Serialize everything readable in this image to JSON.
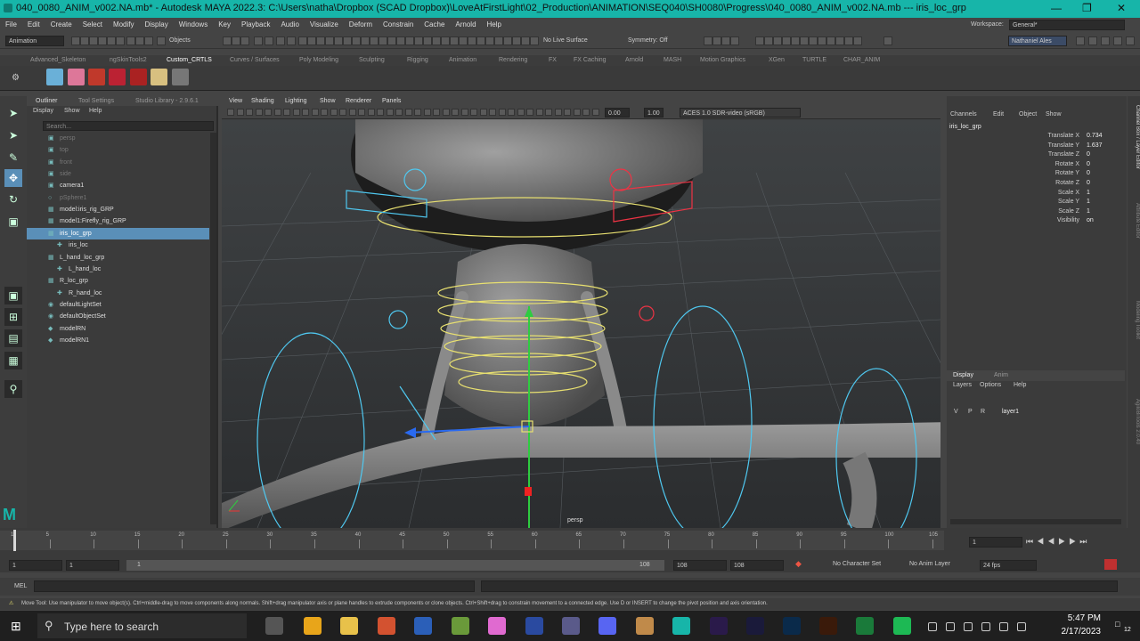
{
  "window": {
    "title": "040_0080_ANIM_v002.NA.mb* - Autodesk MAYA 2022.3: C:\\Users\\natha\\Dropbox (SCAD Dropbox)\\LoveAtFirstLight\\02_Production\\ANIMATION\\SEQ040\\SH0080\\Progress\\040_0080_ANIM_v002.NA.mb   ---   iris_loc_grp"
  },
  "menus": [
    "File",
    "Edit",
    "Create",
    "Select",
    "Modify",
    "Display",
    "Windows",
    "Key",
    "Playback",
    "Audio",
    "Visualize",
    "Deform",
    "Constrain",
    "Cache",
    "Arnold",
    "Help"
  ],
  "workspace": {
    "label": "Workspace:",
    "value": "General*"
  },
  "statusline": {
    "mode": "Animation",
    "objects": "Objects",
    "live_surface": "No Live Surface",
    "symmetry": "Symmetry: Off",
    "user": "Nathaniel Ales"
  },
  "shelf_tabs": [
    "Advanced_Skeleton",
    "ngSkinTools2",
    "Custom_CRTLS",
    "Curves / Surfaces",
    "Poly Modeling",
    "Sculpting",
    "Rigging",
    "Animation",
    "Rendering",
    "FX",
    "FX Caching",
    "Arnold",
    "MASH",
    "Motion Graphics",
    "XGen",
    "TURTLE",
    "CHAR_ANIM"
  ],
  "shelf_icons": [
    {
      "name": "bhGhost",
      "color": "#6ab0d8"
    },
    {
      "name": "Picker",
      "color": "#d79"
    },
    {
      "name": "Picker2",
      "color": "#c0392b"
    },
    {
      "name": "rig-icon",
      "color": "#b23"
    },
    {
      "name": "rig-icon-2",
      "color": "#a22"
    },
    {
      "name": "tweener",
      "color": "#d8c080"
    },
    {
      "name": "maya-icon",
      "color": "#777"
    }
  ],
  "outliner": {
    "tabs": [
      "Outliner",
      "Tool Settings",
      "Studio Library - 2.9.6.1"
    ],
    "menu": [
      "Display",
      "Show",
      "Help"
    ],
    "search_placeholder": "Search...",
    "items": [
      {
        "label": "persp",
        "indent": 0,
        "state": "dim",
        "icon": "camera-icon"
      },
      {
        "label": "top",
        "indent": 0,
        "state": "dim",
        "icon": "camera-icon"
      },
      {
        "label": "front",
        "indent": 0,
        "state": "dim",
        "icon": "camera-icon"
      },
      {
        "label": "side",
        "indent": 0,
        "state": "dim",
        "icon": "camera-icon"
      },
      {
        "label": "camera1",
        "indent": 0,
        "state": "",
        "icon": "camera-icon"
      },
      {
        "label": "pSphere1",
        "indent": 0,
        "state": "dim",
        "icon": "mesh-icon"
      },
      {
        "label": "model:iris_rig_GRP",
        "indent": 0,
        "state": "",
        "icon": "group-icon"
      },
      {
        "label": "model1:Firefly_rig_GRP",
        "indent": 0,
        "state": "",
        "icon": "group-icon"
      },
      {
        "label": "iris_loc_grp",
        "indent": 0,
        "state": "sel",
        "icon": "group-icon"
      },
      {
        "label": "iris_loc",
        "indent": 1,
        "state": "",
        "icon": "locator-icon"
      },
      {
        "label": "L_hand_loc_grp",
        "indent": 0,
        "state": "",
        "icon": "group-icon"
      },
      {
        "label": "L_hand_loc",
        "indent": 1,
        "state": "",
        "icon": "locator-icon"
      },
      {
        "label": "R_loc_grp",
        "indent": 0,
        "state": "",
        "icon": "group-icon"
      },
      {
        "label": "R_hand_loc",
        "indent": 1,
        "state": "",
        "icon": "locator-icon"
      },
      {
        "label": "defaultLightSet",
        "indent": 0,
        "state": "",
        "icon": "set-icon"
      },
      {
        "label": "defaultObjectSet",
        "indent": 0,
        "state": "",
        "icon": "set-icon"
      },
      {
        "label": "modelRN",
        "indent": 0,
        "state": "",
        "icon": "reference-icon"
      },
      {
        "label": "modelRN1",
        "indent": 0,
        "state": "",
        "icon": "reference-icon"
      }
    ]
  },
  "viewport": {
    "menu": [
      "View",
      "Shading",
      "Lighting",
      "Show",
      "Renderer",
      "Panels"
    ],
    "exposure": "0.00",
    "gamma": "1.00",
    "colorspace": "ACES 1.0 SDR-video (sRGB)",
    "camera_label": "persp"
  },
  "channelbox": {
    "menu": [
      "Channels",
      "Edit",
      "Object",
      "Show"
    ],
    "object_name": "iris_loc_grp",
    "channels": [
      {
        "name": "Translate X",
        "value": "0.734"
      },
      {
        "name": "Translate Y",
        "value": "1.637"
      },
      {
        "name": "Translate Z",
        "value": "0"
      },
      {
        "name": "Rotate X",
        "value": "0"
      },
      {
        "name": "Rotate Y",
        "value": "0"
      },
      {
        "name": "Rotate Z",
        "value": "0"
      },
      {
        "name": "Scale X",
        "value": "1"
      },
      {
        "name": "Scale Y",
        "value": "1"
      },
      {
        "name": "Scale Z",
        "value": "1"
      },
      {
        "name": "Visibility",
        "value": "on"
      }
    ],
    "layer_tabs": [
      "Display",
      "Anim"
    ],
    "layer_menu": [
      "Layers",
      "Options",
      "Help"
    ],
    "layer_flags": [
      "V",
      "P",
      "R"
    ],
    "layer_name": "layer1",
    "side_tabs": [
      "Channel Box / Layer Editor",
      "Attribute Editor",
      "Modeling Toolkit",
      "AgiloBiTools 2.0.40"
    ]
  },
  "timeline": {
    "ticks": [
      "1",
      "5",
      "10",
      "15",
      "20",
      "25",
      "30",
      "35",
      "40",
      "45",
      "50",
      "55",
      "60",
      "65",
      "70",
      "75",
      "80",
      "85",
      "90",
      "95",
      "100",
      "105"
    ],
    "current_frame": "1",
    "highlight_frame": "60"
  },
  "range": {
    "start": "1",
    "playback_start": "1",
    "slider_start": "1",
    "slider_end": "108",
    "playback_end": "108",
    "end": "108",
    "character_set": "No Character Set",
    "anim_layer": "No Anim Layer",
    "fps": "24 fps"
  },
  "mel": {
    "label": "MEL"
  },
  "help_line": "Move Tool: Use manipulator to move object(s). Ctrl+middle-drag to move components along normals. Shift+drag manipulator axis or plane handles to extrude components or clone objects. Ctrl+Shift+drag to constrain movement to a connected edge. Use D or INSERT to change the pivot position and axis orientation.",
  "taskbar": {
    "search_placeholder": "Type here to search",
    "time": "5:47 PM",
    "date": "2/17/2023",
    "notification_count": "12"
  }
}
